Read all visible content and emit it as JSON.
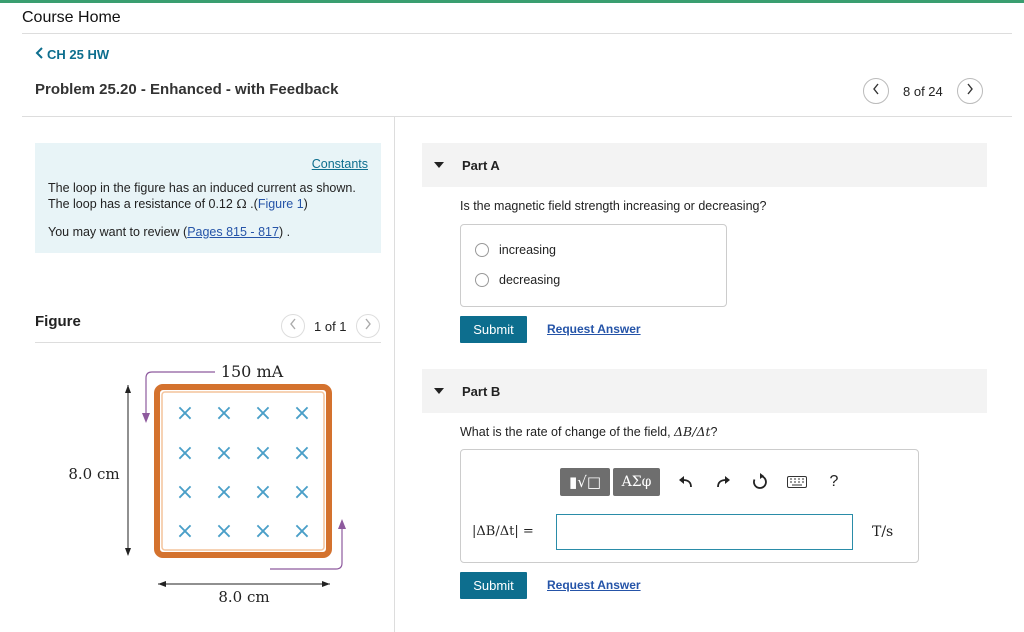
{
  "header": {
    "course_home": "Course Home",
    "breadcrumb": "CH 25 HW"
  },
  "problem": {
    "title": "Problem 25.20 - Enhanced - with Feedback",
    "pager_text": "8 of 24"
  },
  "info": {
    "constants_label": "Constants",
    "line1": "The loop in the figure has an induced current as shown.",
    "line2_pre": "The loop has a resistance of 0.12",
    "line2_unit": "Ω",
    "line2_mid": " .(",
    "figure_link": "Figure 1",
    "line2_end": ")",
    "review_pre": "You may want to review (",
    "review_link": "Pages 815 - 817",
    "review_end": ") ."
  },
  "figure": {
    "label": "Figure",
    "pager_text": "1 of 1",
    "current_label": "150 mA",
    "height_label": "8.0 cm",
    "width_label": "8.0 cm",
    "field_symbol": "×",
    "loop_color": "#d4722e",
    "current_arrow_color": "#8e5a9e",
    "field_color": "#4a9fc8"
  },
  "part_a": {
    "title": "Part A",
    "question": "Is the magnetic field strength increasing or decreasing?",
    "options": [
      "increasing",
      "decreasing"
    ],
    "submit_label": "Submit",
    "request_label": "Request Answer"
  },
  "part_b": {
    "title": "Part B",
    "question_pre": "What is the rate of change of the field, ",
    "question_math": "ΔB/Δt",
    "question_end": "?",
    "toolbar": {
      "templates": "▮√□",
      "greek": "ΑΣφ",
      "help": "?"
    },
    "answer_label": "|ΔB/Δt| =",
    "answer_value": "",
    "unit": "T/s",
    "submit_label": "Submit",
    "request_label": "Request Answer"
  },
  "colors": {
    "accent": "#0d6e8e",
    "top_bar": "#3a9e70",
    "info_bg": "#e8f4f7",
    "link": "#2554a8"
  }
}
